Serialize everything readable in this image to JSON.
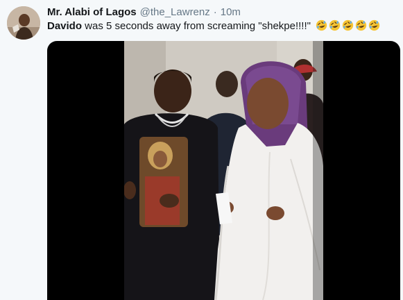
{
  "tweet": {
    "display_name": "Mr. Alabi of Lagos",
    "handle": "@the_Lawrenz",
    "separator": "·",
    "time": "10m",
    "mention": "Davido",
    "text_rest": " was 5 seconds away from screaming \"shekpe!!!!\"",
    "emoji": [
      "rolling-on-floor-laughing",
      "rolling-on-floor-laughing",
      "rolling-on-floor-laughing",
      "rolling-on-floor-laughing",
      "rolling-on-floor-laughing"
    ]
  },
  "colors": {
    "background": "#f5f8fa",
    "secondary_text": "#657786",
    "primary_text": "#14171a",
    "media_letterbox": "#000000"
  }
}
